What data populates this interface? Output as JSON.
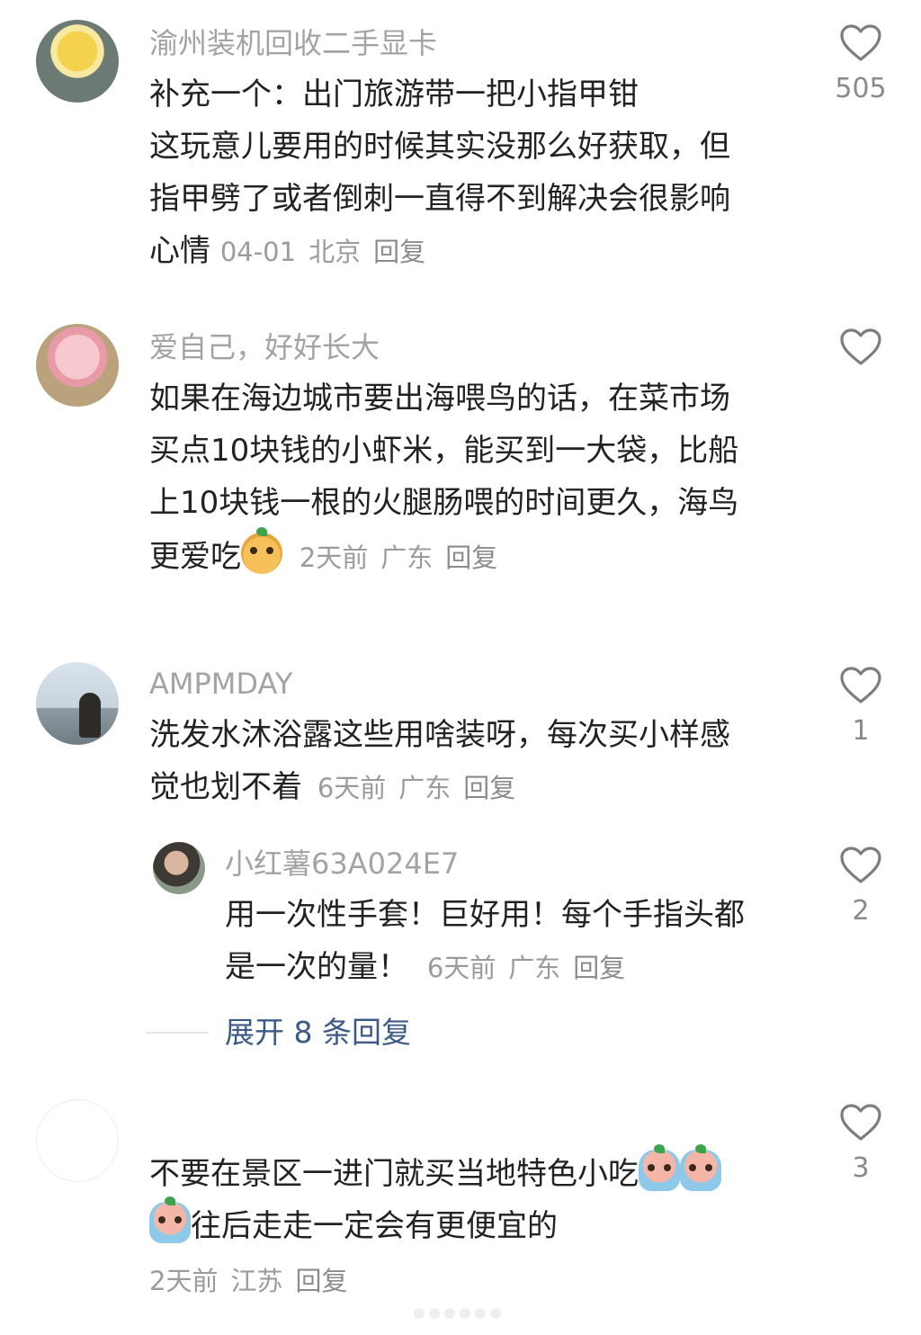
{
  "comments": [
    {
      "username": "渝州装机回收二手显卡",
      "lines": [
        "补充一个：出门旅游带一把小指甲钳",
        "这玩意儿要用的时候其实没那么好获取，但",
        "指甲劈了或者倒刺一直得不到解决会很影响"
      ],
      "last_line": "心情",
      "date": "04-01",
      "location": "北京",
      "reply_label": "回复",
      "like_count": "505"
    },
    {
      "username": "爱自己，好好长大",
      "lines": [
        "如果在海边城市要出海喂鸟的话，在菜市场",
        "买点10块钱的小虾米，能买到一大袋，比船",
        "上10块钱一根的火腿肠喂的时间更久，海鸟"
      ],
      "last_line": "更爱吃",
      "date": "2天前",
      "location": "广东",
      "reply_label": "回复",
      "like_count": ""
    },
    {
      "username": "AMPMDAY",
      "lines": [
        "洗发水沐浴露这些用啥装呀，每次买小样感"
      ],
      "last_line": "觉也划不着",
      "date": "6天前",
      "location": "广东",
      "reply_label": "回复",
      "like_count": "1"
    },
    {
      "username": "小红薯63A024E7",
      "lines": [
        "用一次性手套！巨好用！每个手指头都"
      ],
      "last_line": "是一次的量！",
      "date": "6天前",
      "location": "广东",
      "reply_label": "回复",
      "like_count": "2"
    },
    {
      "username": "",
      "lines": [
        "不要在景区一进门就买当地特色小吃"
      ],
      "last_line": "往后走走一定会有更便宜的",
      "date": "2天前",
      "location": "江苏",
      "reply_label": "回复",
      "like_count": "3"
    }
  ],
  "expand_replies": "展开 8 条回复",
  "icons": {
    "like": "heart-outline-icon",
    "emoji_sticker": "orange-face-emoji-icon",
    "emoji_cry": "crying-emoji-icon"
  },
  "colors": {
    "text": "#222222",
    "username": "#a3a3a3",
    "meta": "#9b9b9b",
    "expand": "#3c5a86"
  }
}
